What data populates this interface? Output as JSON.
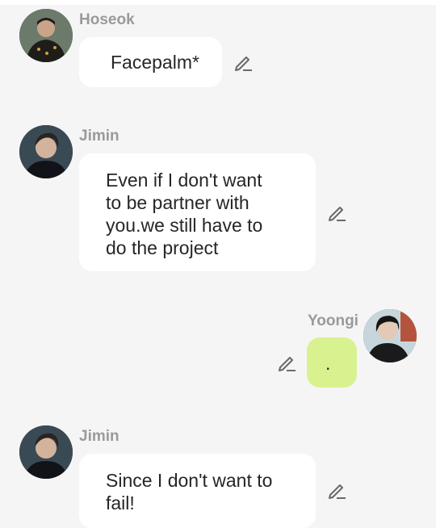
{
  "messages": [
    {
      "sender": "Hoseok",
      "text": "Facepalm*",
      "avatar_icon": "hoseok-avatar",
      "side": "left"
    },
    {
      "sender": "Jimin",
      "text": "Even if I don't want\nto be partner with\nyou.we still have to\ndo the project",
      "avatar_icon": "jimin-avatar",
      "side": "left"
    },
    {
      "sender": "Yoongi",
      "text": ".",
      "avatar_icon": "yoongi-avatar",
      "side": "right"
    },
    {
      "sender": "Jimin",
      "text": "Since I don't want to\nfail!",
      "avatar_icon": "jimin-avatar",
      "side": "left"
    }
  ],
  "icons": {
    "edit": "pencil-edit-icon"
  },
  "colors": {
    "background": "#f5f5f5",
    "bubble": "#ffffff",
    "my_bubble": "#d8f28f",
    "name": "#9a9a9a",
    "text": "#262626"
  }
}
